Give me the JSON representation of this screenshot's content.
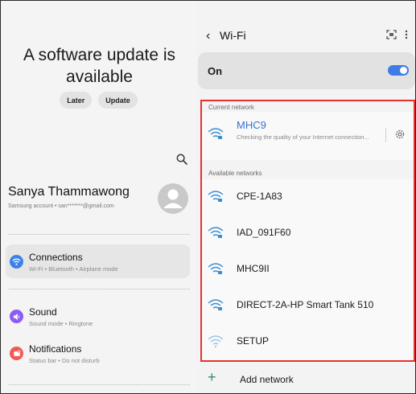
{
  "left": {
    "update": {
      "title": "A software update is available",
      "later": "Later",
      "update": "Update"
    },
    "search_icon": "search-icon",
    "profile": {
      "name": "Sanya Thammawong",
      "account": "Samsung account  •  san*******@gmail.com",
      "avatar_icon": "person-icon"
    },
    "menu": [
      {
        "title": "Connections",
        "sub": "Wi-Fi  •  Bluetooth  •  Airplane mode",
        "icon": "wifi-icon",
        "color": "#3b82e8"
      },
      {
        "title": "Sound",
        "sub": "Sound mode  •  Ringtone",
        "icon": "speaker-icon",
        "color": "#8c5cf0"
      },
      {
        "title": "Notifications",
        "sub": "Status bar  •  Do not disturb",
        "icon": "bell-icon",
        "color": "#ef5a56"
      }
    ]
  },
  "right": {
    "header": {
      "back_icon": "chevron-left-icon",
      "title": "Wi-Fi",
      "scan_icon": "qr-scan-icon",
      "more_icon": "more-vert-icon"
    },
    "master_toggle": {
      "label": "On",
      "state": true,
      "accent": "#3e7be4"
    },
    "current_label": "Current network",
    "current": {
      "name": "MHC9",
      "status": "Checking the quality of your Internet connection...",
      "gear_icon": "gear-icon"
    },
    "available_label": "Available networks",
    "available": [
      {
        "name": "CPE-1A83"
      },
      {
        "name": "IAD_091F60"
      },
      {
        "name": "MHC9II"
      },
      {
        "name": "DIRECT-2A-HP Smart Tank 510"
      },
      {
        "name": "SETUP"
      }
    ],
    "add_network": {
      "label": "Add network",
      "icon": "plus-icon"
    },
    "highlight_color": "#e53030"
  }
}
